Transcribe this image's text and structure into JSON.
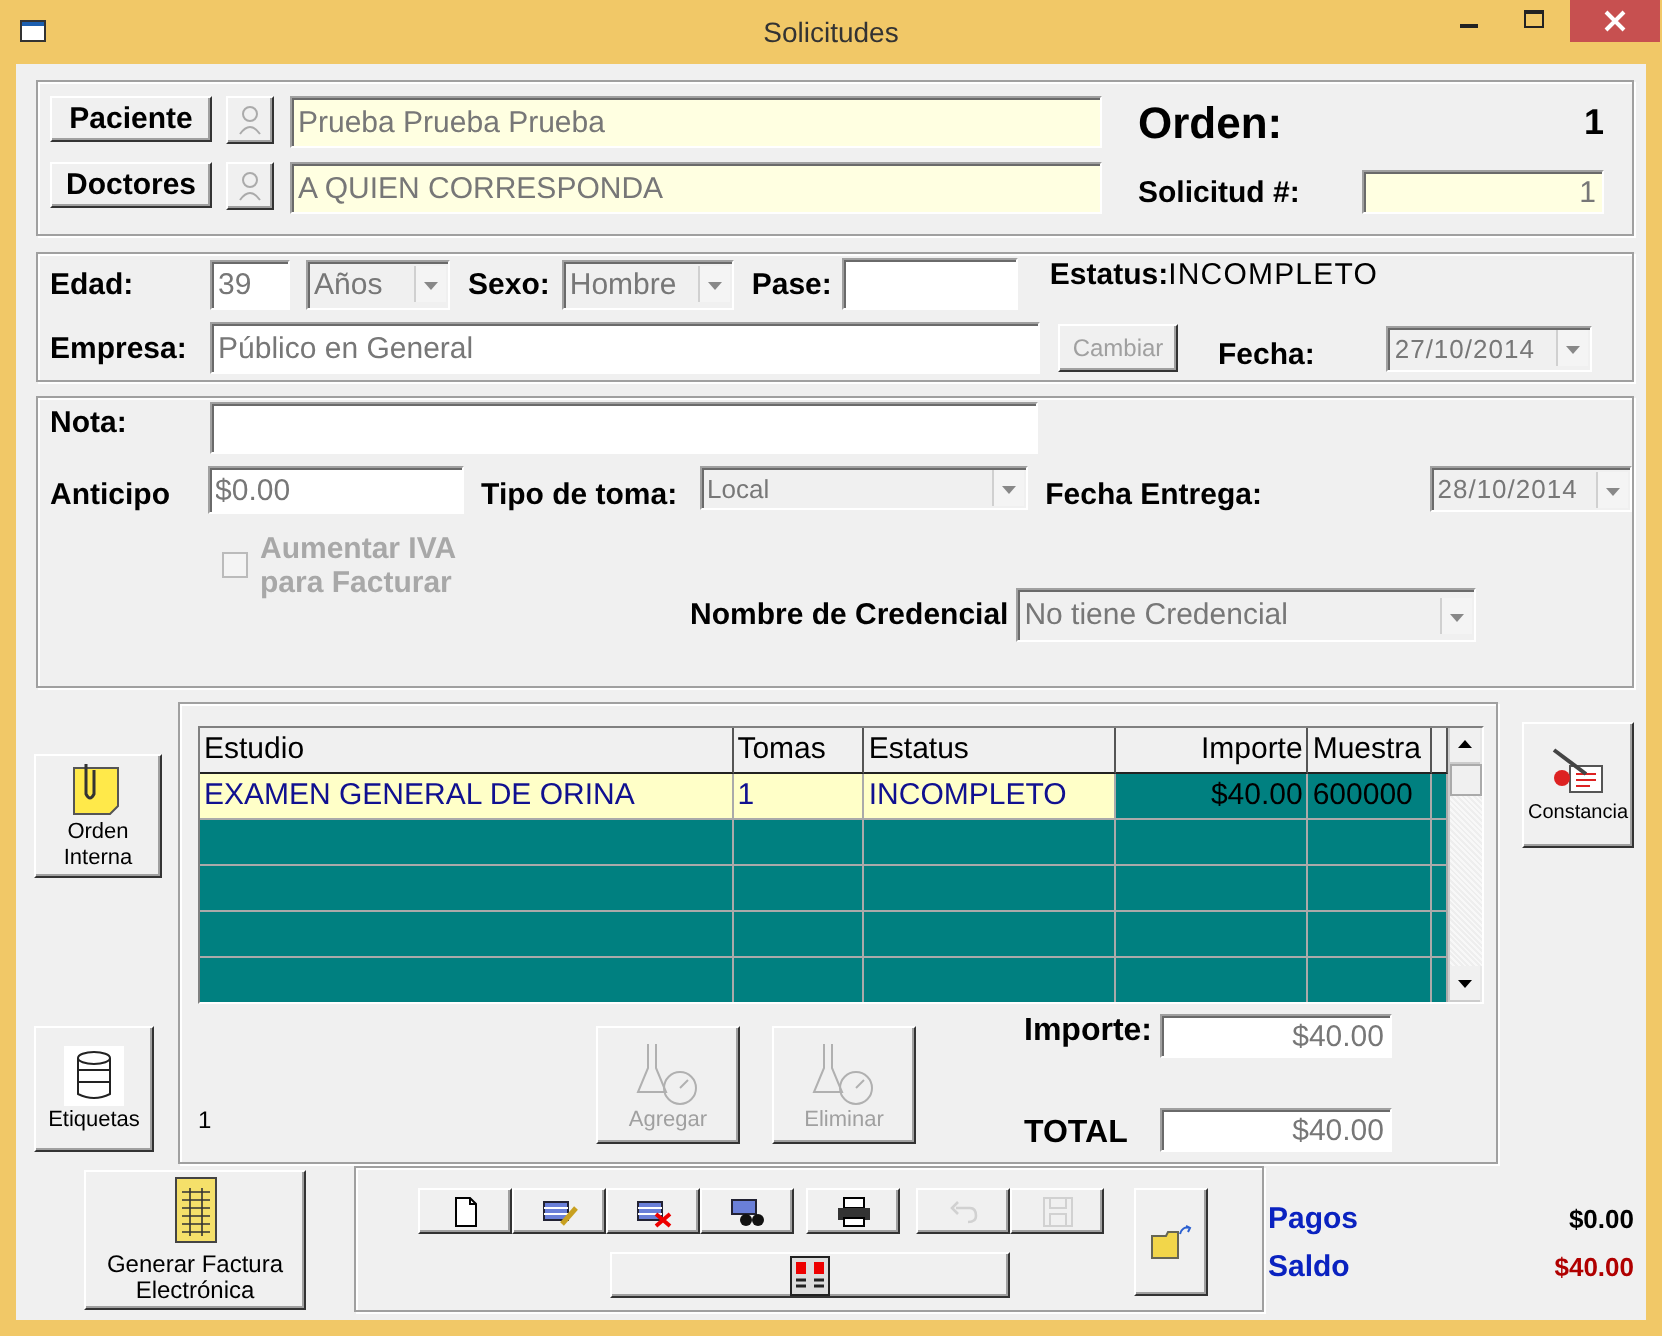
{
  "window": {
    "title": "Solicitudes"
  },
  "patient": {
    "button": "Paciente",
    "value": "Prueba Prueba Prueba",
    "icon_disabled": true
  },
  "doctor": {
    "button": "Doctores",
    "value": "A QUIEN CORRESPONDA",
    "icon_disabled": true
  },
  "orden": {
    "label": "Orden:",
    "value": "1"
  },
  "solicitud": {
    "label": "Solicitud #:",
    "value": "1"
  },
  "edad": {
    "label": "Edad:",
    "value": "39",
    "unit": "Años"
  },
  "sexo": {
    "label": "Sexo:",
    "value": "Hombre"
  },
  "pase": {
    "label": "Pase:"
  },
  "estatus": {
    "label": "Estatus:",
    "value": "INCOMPLETO"
  },
  "empresa": {
    "label": "Empresa:",
    "value": "Público en General",
    "button": "Cambiar",
    "button_disabled": true
  },
  "fecha": {
    "label": "Fecha:",
    "value": "27/10/2014"
  },
  "nota": {
    "label": "Nota:"
  },
  "anticipo": {
    "label": "Anticipo",
    "value": "$0.00"
  },
  "tipo_toma": {
    "label": "Tipo de toma:",
    "value": "Local"
  },
  "fecha_entrega": {
    "label": "Fecha Entrega:",
    "value": "28/10/2014"
  },
  "iva": {
    "label": "Aumentar IVA para Facturar",
    "checked": false,
    "disabled": true
  },
  "credencial": {
    "label": "Nombre de Credencial",
    "value": "No tiene Credencial"
  },
  "orden_interna_button": "Orden Interna",
  "etiquetas_button": "Etiquetas",
  "constancia_button": "Constancia",
  "table": {
    "columns": [
      {
        "label": "Estudio",
        "kind": "text"
      },
      {
        "label": "Tomas",
        "kind": "text"
      },
      {
        "label": "Estatus",
        "kind": "text"
      },
      {
        "label": "Importe",
        "kind": "amount"
      },
      {
        "label": "Muestra",
        "kind": "code"
      }
    ],
    "rows": [
      {
        "selected": true,
        "cells": [
          "EXAMEN GENERAL DE ORINA",
          "1",
          "INCOMPLETO",
          "$40.00",
          "600000"
        ]
      }
    ]
  },
  "row_count": "1",
  "actions": [
    {
      "label": "Agregar",
      "disabled": true
    },
    {
      "label": "Eliminar",
      "disabled": true
    }
  ],
  "importe": {
    "label": "Importe:",
    "value": "$40.00"
  },
  "total": {
    "label": "TOTAL",
    "value": "$40.00"
  },
  "factura_button": "Generar Factura Electrónica",
  "toolbar": [
    {
      "kind": "new",
      "disabled": false
    },
    {
      "kind": "edit",
      "disabled": false
    },
    {
      "kind": "delete",
      "disabled": false
    },
    {
      "kind": "find",
      "disabled": false
    },
    {
      "kind": "print",
      "disabled": false
    },
    {
      "kind": "undo",
      "disabled": true
    },
    {
      "kind": "save",
      "disabled": true
    }
  ],
  "pagos": {
    "label": "Pagos",
    "value": "$0.00"
  },
  "saldo": {
    "label": "Saldo",
    "value": "$40.00"
  }
}
